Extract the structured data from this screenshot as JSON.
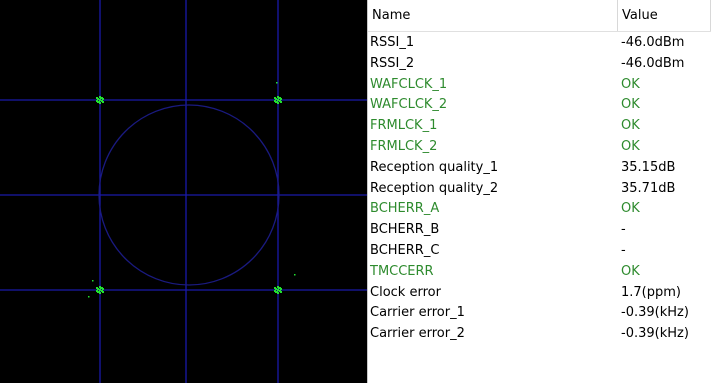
{
  "colors": {
    "scope_bg": "#000000",
    "grid": "#1a1aa8",
    "circle": "#1a1a80",
    "constellation_points": "#22e030",
    "status_ok": "#2e8b2e",
    "text": "#000000"
  },
  "table": {
    "headers": {
      "name": "Name",
      "value": "Value"
    },
    "rows": [
      {
        "name": "RSSI_1",
        "value": "-46.0dBm",
        "status": "normal"
      },
      {
        "name": "RSSI_2",
        "value": "-46.0dBm",
        "status": "normal"
      },
      {
        "name": "WAFCLCK_1",
        "value": "OK",
        "status": "ok"
      },
      {
        "name": "WAFCLCK_2",
        "value": "OK",
        "status": "ok"
      },
      {
        "name": "FRMLCK_1",
        "value": "OK",
        "status": "ok"
      },
      {
        "name": "FRMLCK_2",
        "value": "OK",
        "status": "ok"
      },
      {
        "name": "Reception quality_1",
        "value": "35.15dB",
        "status": "normal"
      },
      {
        "name": "Reception quality_2",
        "value": "35.71dB",
        "status": "normal"
      },
      {
        "name": "BCHERR_A",
        "value": "OK",
        "status": "ok"
      },
      {
        "name": "BCHERR_B",
        "value": "-",
        "status": "normal"
      },
      {
        "name": "BCHERR_C",
        "value": "-",
        "status": "normal"
      },
      {
        "name": "TMCCERR",
        "value": "OK",
        "status": "ok"
      },
      {
        "name": "Clock error",
        "value": "1.7(ppm)",
        "status": "normal"
      },
      {
        "name": "Carrier error_1",
        "value": "-0.39(kHz)",
        "status": "normal"
      },
      {
        "name": "Carrier error_2",
        "value": "-0.39(kHz)",
        "status": "normal"
      }
    ]
  }
}
